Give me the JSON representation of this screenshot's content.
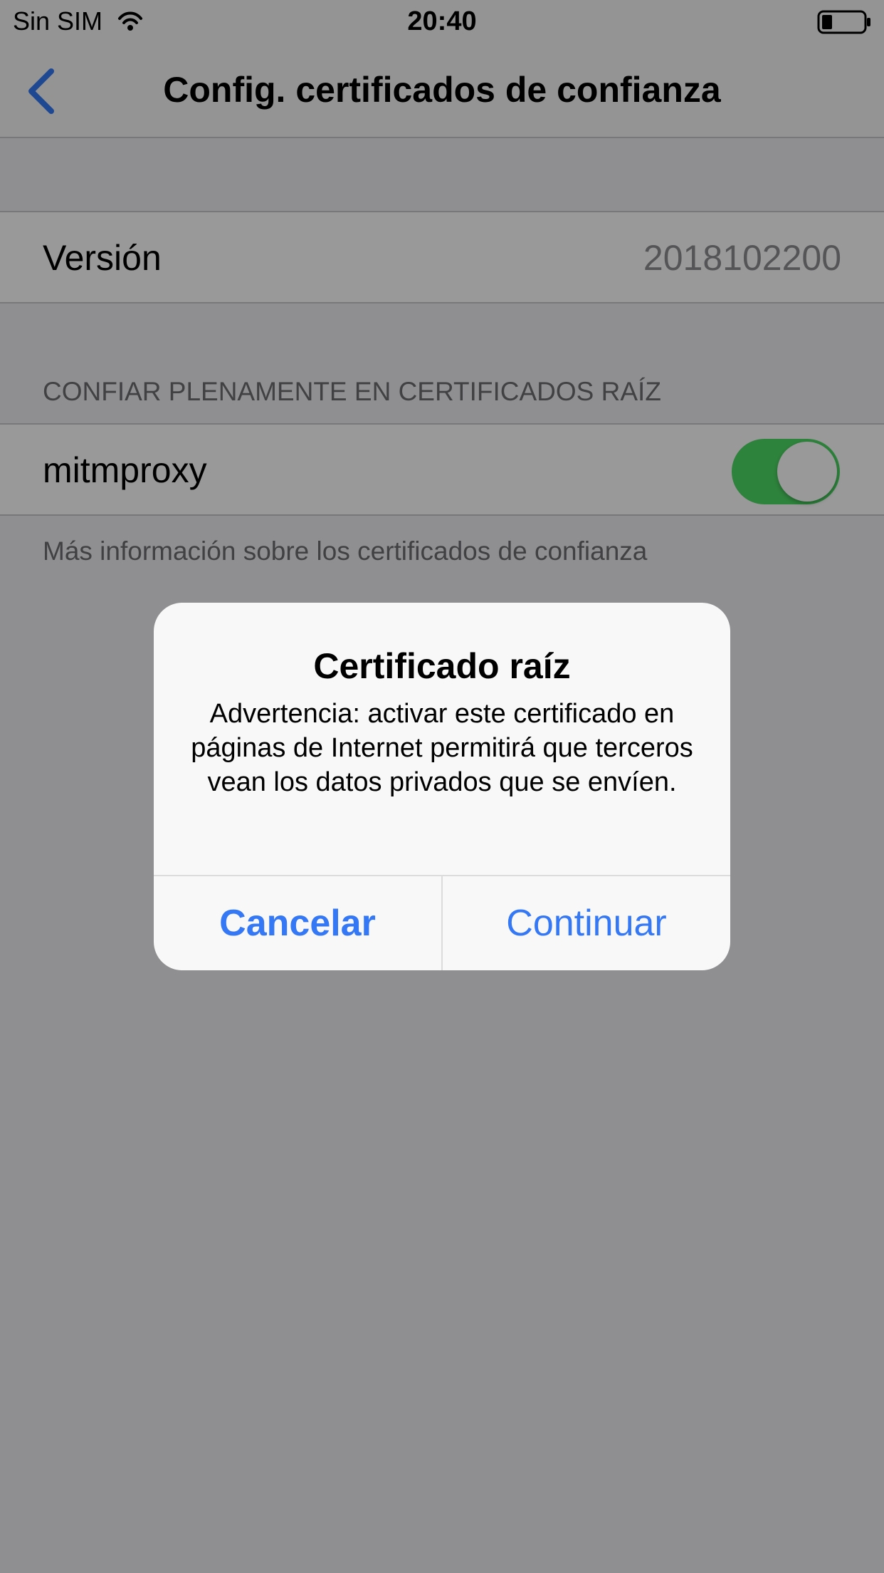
{
  "status_bar": {
    "carrier": "Sin SIM",
    "time": "20:40",
    "wifi_icon": "wifi-icon",
    "battery_icon": "battery-icon"
  },
  "nav": {
    "back_icon": "chevron-left-icon",
    "title": "Config. certificados de confianza"
  },
  "version_row": {
    "label": "Versión",
    "value": "2018102200"
  },
  "section": {
    "header": "CONFIAR PLENAMENTE EN CERTIFICADOS RAÍZ",
    "footer": "Más información sobre los certificados de confianza",
    "items": [
      {
        "label": "mitmproxy",
        "enabled": true
      }
    ]
  },
  "colors": {
    "toggle_on": "#4cd964",
    "link_blue": "#3478f6"
  },
  "alert": {
    "title": "Certificado raíz",
    "message": "Advertencia: activar este certificado en páginas de Internet permitirá que terceros vean los datos privados que se envíen.",
    "cancel_label": "Cancelar",
    "continue_label": "Continuar"
  }
}
